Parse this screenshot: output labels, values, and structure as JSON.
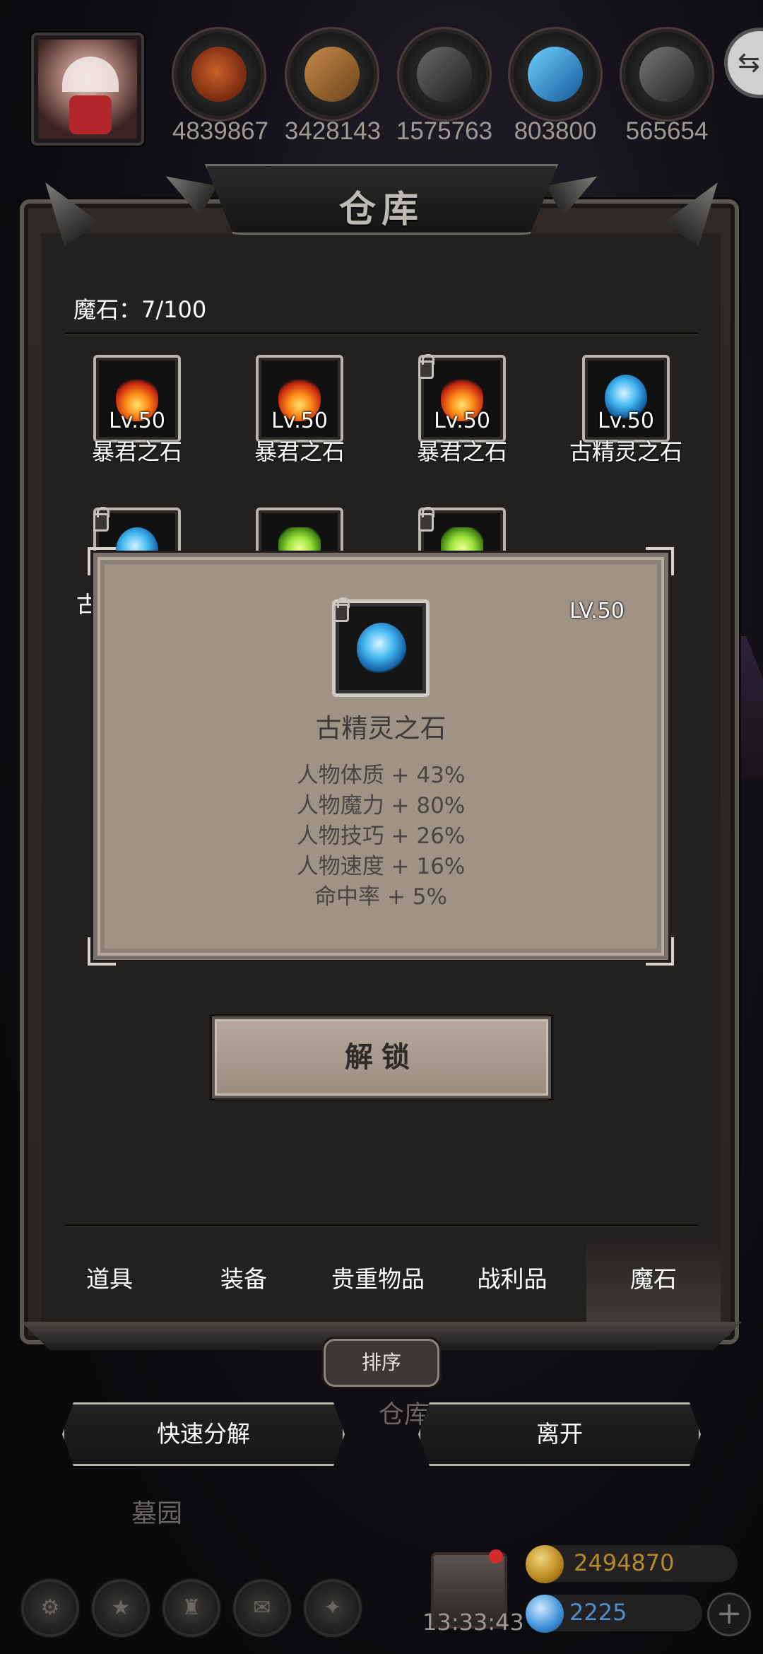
{
  "resources": [
    {
      "icon": "meat-icon",
      "value": "4839867"
    },
    {
      "icon": "wood-icon",
      "value": "3428143"
    },
    {
      "icon": "iron-icon",
      "value": "1575763"
    },
    {
      "icon": "crystal-icon",
      "value": "803800"
    },
    {
      "icon": "stone-icon",
      "value": "565654"
    }
  ],
  "panel": {
    "title": "仓库",
    "count": "魔石：7/100"
  },
  "items": [
    {
      "level": "Lv.50",
      "name": "暴君之石",
      "gem": "fire",
      "locked": false
    },
    {
      "level": "Lv.50",
      "name": "暴君之石",
      "gem": "fire",
      "locked": false
    },
    {
      "level": "Lv.50",
      "name": "暴君之石",
      "gem": "fire",
      "locked": true
    },
    {
      "level": "Lv.50",
      "name": "古精灵之石",
      "gem": "ice",
      "locked": false
    },
    {
      "level": "",
      "name": "古",
      "gem": "ice",
      "locked": true
    },
    {
      "level": "",
      "name": "",
      "gem": "green",
      "locked": false
    },
    {
      "level": "",
      "name": "",
      "gem": "green",
      "locked": true
    }
  ],
  "tooltip": {
    "level": "LV.50",
    "name": "古精灵之石",
    "stats": [
      "人物体质 + 43%",
      "人物魔力 + 80%",
      "人物技巧 + 26%",
      "人物速度 + 16%",
      "命中率 + 5%"
    ]
  },
  "unlock_label": "解锁",
  "tabs": [
    "道具",
    "装备",
    "贵重物品",
    "战利品",
    "魔石"
  ],
  "active_tab": "魔石",
  "sort_label": "排序",
  "quick_dismantle_label": "快速分解",
  "leave_label": "离开",
  "background_labels": {
    "warehouse": "仓库",
    "cemetery": "墓园"
  },
  "hud": {
    "time": "13:33:43",
    "gold": "2494870",
    "gems": "2225"
  },
  "colors": {
    "gold_text": "#b08a2c",
    "gem_text": "#4f8fd0"
  }
}
